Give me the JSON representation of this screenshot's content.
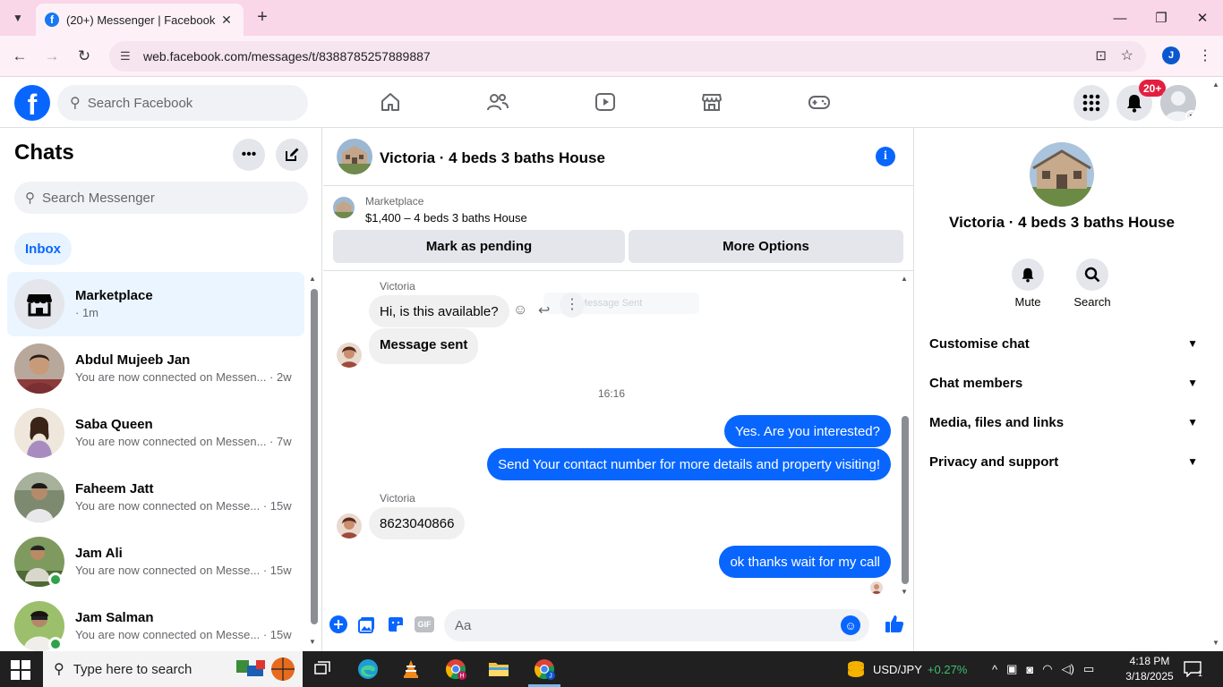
{
  "browser": {
    "tab_title": "(20+) Messenger | Facebook",
    "url": "web.facebook.com/messages/t/8388785257889887"
  },
  "fb": {
    "search_placeholder": "Search Facebook",
    "notification_badge": "20+",
    "profile_initial": "J"
  },
  "chats": {
    "title": "Chats",
    "search_placeholder": "Search Messenger",
    "inbox_label": "Inbox",
    "items": [
      {
        "name": "Marketplace",
        "preview": "· 1m",
        "online": false,
        "active": true
      },
      {
        "name": "Abdul Mujeeb Jan",
        "preview": "You are now connected on Messen... · 2w",
        "online": false,
        "active": false
      },
      {
        "name": "Saba Queen",
        "preview": "You are now connected on Messen... · 7w",
        "online": false,
        "active": false
      },
      {
        "name": "Faheem Jatt",
        "preview": "You are now connected on Messe... · 15w",
        "online": false,
        "active": false
      },
      {
        "name": "Jam Ali",
        "preview": "You are now connected on Messe... · 15w",
        "online": true,
        "active": false
      },
      {
        "name": "Jam Salman",
        "preview": "You are now connected on Messe... · 15w",
        "online": true,
        "active": false
      }
    ]
  },
  "conversation": {
    "title": "Victoria · 4 beds 3 baths House",
    "marketplace_label": "Marketplace",
    "listing": "$1,400 – 4 beds 3 baths House",
    "btn_pending": "Mark as pending",
    "btn_options": "More Options",
    "ghost_text": "Message Sent",
    "messages": [
      {
        "sender": "Victoria",
        "text": "Hi, is this available?"
      },
      {
        "text": "Message sent"
      },
      {
        "timestamp": "16:16"
      },
      {
        "text": "Yes. Are you interested?"
      },
      {
        "text": "Send Your contact number for more details and property visiting!"
      },
      {
        "sender": "Victoria",
        "text": "8623040866"
      },
      {
        "text": "ok thanks wait for my call"
      }
    ],
    "composer_placeholder": "Aa",
    "gif_label": "GIF"
  },
  "details": {
    "title": "Victoria · 4 beds 3 baths House",
    "actions": [
      "Mute",
      "Search"
    ],
    "sections": [
      "Customise chat",
      "Chat members",
      "Media, files and links",
      "Privacy and support"
    ]
  },
  "taskbar": {
    "search_placeholder": "Type here to search",
    "ticker_symbol": "USD/JPY",
    "ticker_change": "+0.27%",
    "time": "4:18 PM",
    "date": "3/18/2025",
    "notif_count": "1",
    "colors": {
      "ticker_positive": "#3fbf6f",
      "accent": "#0866ff"
    }
  }
}
